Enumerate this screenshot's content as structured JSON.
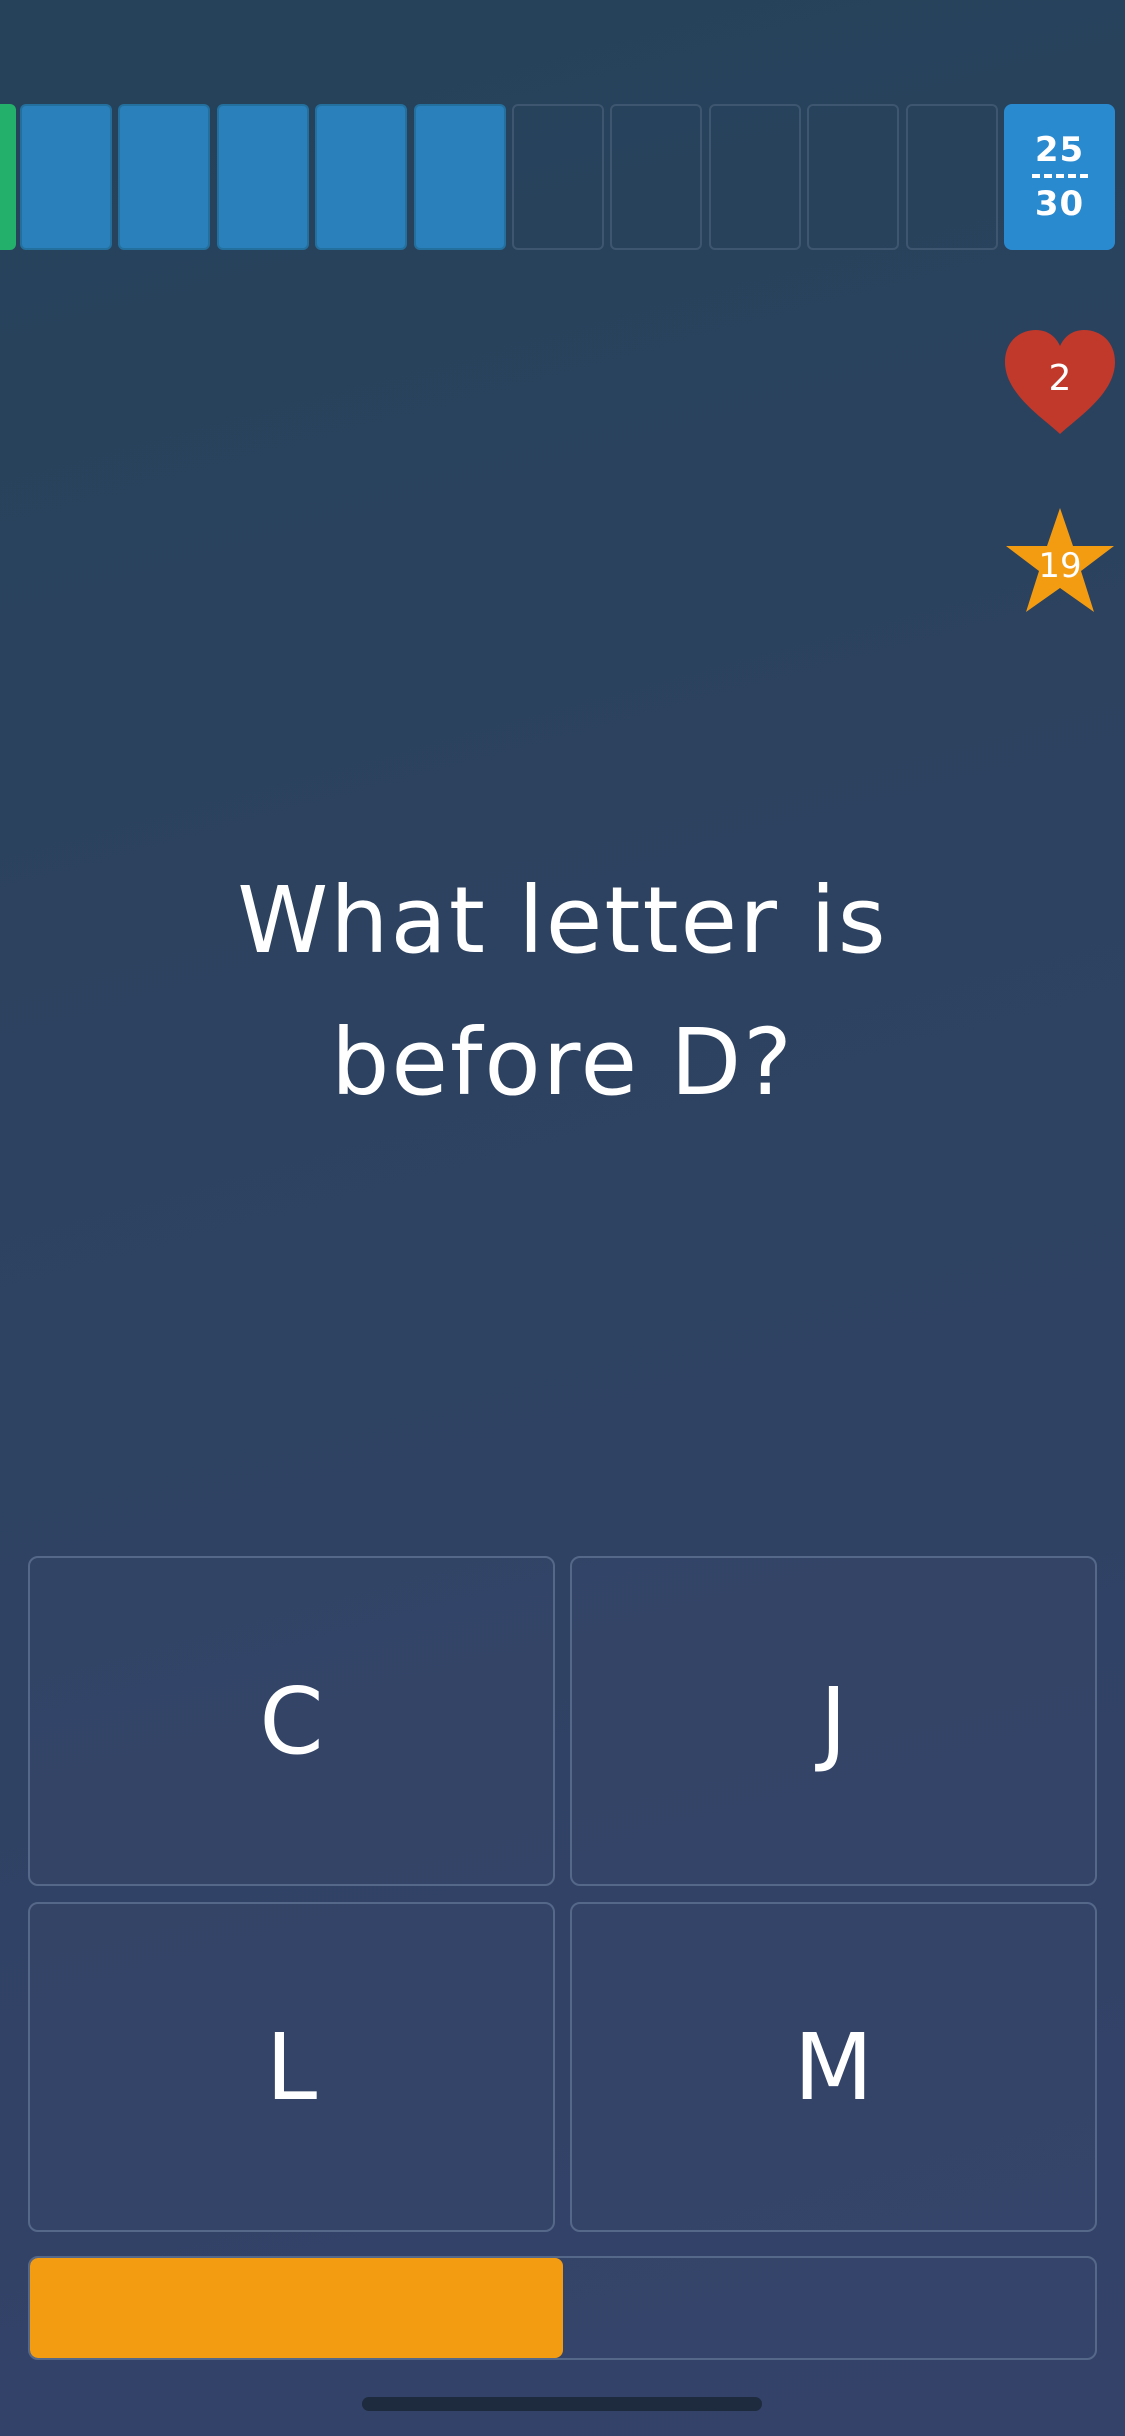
{
  "progress": {
    "completed_cells": 5,
    "pending_cells": 5,
    "counter_current": "25",
    "counter_total": "30",
    "colors": {
      "done": "#2980ba",
      "correct": "#23b06a",
      "counter": "#2a8ad0"
    }
  },
  "status": {
    "lives": "2",
    "lives_icon": "heart-icon",
    "lives_color": "#c0392b",
    "stars": "19",
    "stars_icon": "star-icon",
    "stars_color": "#f39c12"
  },
  "question": {
    "line1": "What letter is",
    "line2": "before D?"
  },
  "answers": [
    {
      "label": "C"
    },
    {
      "label": "J"
    },
    {
      "label": "L"
    },
    {
      "label": "M"
    }
  ],
  "timer": {
    "remaining_fraction": 0.5,
    "color": "#f39c12"
  }
}
